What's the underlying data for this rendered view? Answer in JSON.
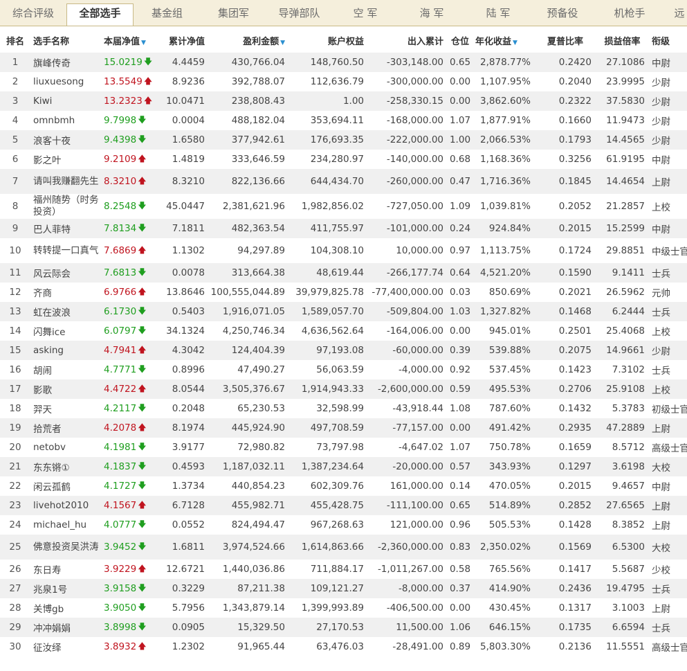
{
  "tabs": [
    {
      "label": "综合评级",
      "active": false
    },
    {
      "label": "全部选手",
      "active": true
    },
    {
      "label": "基金组",
      "active": false
    },
    {
      "label": "集团军",
      "active": false
    },
    {
      "label": "导弹部队",
      "active": false
    },
    {
      "label": "空  军",
      "active": false
    },
    {
      "label": "海  军",
      "active": false
    },
    {
      "label": "陆  军",
      "active": false
    },
    {
      "label": "预备役",
      "active": false
    },
    {
      "label": "机枪手",
      "active": false
    },
    {
      "label": "远",
      "active": false
    }
  ],
  "columns": {
    "rank": "排名",
    "name": "选手名称",
    "nav": "本届净值",
    "cum_nav": "累计净值",
    "profit": "盈利金额",
    "equity": "账户权益",
    "flow": "出入累计",
    "position": "仓位",
    "annual": "年化收益",
    "sharpe": "夏普比率",
    "pl_ratio": "损益倍率",
    "title": "衔级"
  },
  "sort_icon": "sort-desc-triangle",
  "colors": {
    "up": "#c0141f",
    "down": "#1f9e1f",
    "sort": "#2a8fd0"
  },
  "rows": [
    {
      "rank": "1",
      "name": "旗峰传奇",
      "nav": "15.0219",
      "dir": "down",
      "cum_nav": "4.4459",
      "profit": "430,766.04",
      "equity": "148,760.50",
      "flow": "-303,148.00",
      "position": "0.65",
      "annual": "2,878.77%",
      "sharpe": "0.2420",
      "pl_ratio": "27.1086",
      "title": "中尉"
    },
    {
      "rank": "2",
      "name": "liuxuesong",
      "nav": "13.5549",
      "dir": "up",
      "cum_nav": "8.9236",
      "profit": "392,788.07",
      "equity": "112,636.79",
      "flow": "-300,000.00",
      "position": "0.00",
      "annual": "1,107.95%",
      "sharpe": "0.2040",
      "pl_ratio": "23.9995",
      "title": "少尉"
    },
    {
      "rank": "3",
      "name": "Kiwi",
      "nav": "13.2323",
      "dir": "up",
      "cum_nav": "10.0471",
      "profit": "238,808.43",
      "equity": "1.00",
      "flow": "-258,330.15",
      "position": "0.00",
      "annual": "3,862.60%",
      "sharpe": "0.2322",
      "pl_ratio": "37.5830",
      "title": "少尉"
    },
    {
      "rank": "4",
      "name": "omnbmh",
      "nav": "9.7998",
      "dir": "down",
      "cum_nav": "0.0004",
      "profit": "488,182.04",
      "equity": "353,694.11",
      "flow": "-168,000.00",
      "position": "1.07",
      "annual": "1,877.91%",
      "sharpe": "0.1660",
      "pl_ratio": "11.9473",
      "title": "少尉"
    },
    {
      "rank": "5",
      "name": "浪客十夜",
      "nav": "9.4398",
      "dir": "down",
      "cum_nav": "1.6580",
      "profit": "377,942.61",
      "equity": "176,693.35",
      "flow": "-222,000.00",
      "position": "1.00",
      "annual": "2,066.53%",
      "sharpe": "0.1793",
      "pl_ratio": "14.4565",
      "title": "少尉"
    },
    {
      "rank": "6",
      "name": "影之叶",
      "nav": "9.2109",
      "dir": "up",
      "cum_nav": "1.4819",
      "profit": "333,646.59",
      "equity": "234,280.97",
      "flow": "-140,000.00",
      "position": "0.68",
      "annual": "1,168.36%",
      "sharpe": "0.3256",
      "pl_ratio": "61.9195",
      "title": "中尉"
    },
    {
      "rank": "7",
      "name": "请叫我赚翻先生",
      "nav": "8.3210",
      "dir": "up",
      "cum_nav": "8.3210",
      "profit": "822,136.66",
      "equity": "644,434.70",
      "flow": "-260,000.00",
      "position": "0.47",
      "annual": "1,716.36%",
      "sharpe": "0.1845",
      "pl_ratio": "14.4654",
      "title": "上尉",
      "wrap": true
    },
    {
      "rank": "8",
      "name": "福州随势（时务投资）",
      "nav": "8.2548",
      "dir": "down",
      "cum_nav": "45.0447",
      "profit": "2,381,621.96",
      "equity": "1,982,856.02",
      "flow": "-727,050.00",
      "position": "1.09",
      "annual": "1,039.81%",
      "sharpe": "0.2052",
      "pl_ratio": "21.2857",
      "title": "上校",
      "wrap": true
    },
    {
      "rank": "9",
      "name": "巴人菲特",
      "nav": "7.8134",
      "dir": "down",
      "cum_nav": "7.1811",
      "profit": "482,363.54",
      "equity": "411,755.97",
      "flow": "-101,000.00",
      "position": "0.24",
      "annual": "924.84%",
      "sharpe": "0.2015",
      "pl_ratio": "15.2599",
      "title": "中尉"
    },
    {
      "rank": "10",
      "name": "转转提一口真气",
      "nav": "7.6869",
      "dir": "up",
      "cum_nav": "1.1302",
      "profit": "94,297.89",
      "equity": "104,308.10",
      "flow": "10,000.00",
      "position": "0.97",
      "annual": "1,113.75%",
      "sharpe": "0.1724",
      "pl_ratio": "29.8851",
      "title": "中级士官",
      "wrap": true
    },
    {
      "rank": "11",
      "name": "风云际会",
      "nav": "7.6813",
      "dir": "down",
      "cum_nav": "0.0078",
      "profit": "313,664.38",
      "equity": "48,619.44",
      "flow": "-266,177.74",
      "position": "0.64",
      "annual": "4,521.20%",
      "sharpe": "0.1590",
      "pl_ratio": "9.1411",
      "title": "士兵"
    },
    {
      "rank": "12",
      "name": "齐商",
      "nav": "6.9766",
      "dir": "up",
      "cum_nav": "13.8646",
      "profit": "100,555,044.89",
      "equity": "39,979,825.78",
      "flow": "-77,400,000.00",
      "position": "0.03",
      "annual": "850.69%",
      "sharpe": "0.2021",
      "pl_ratio": "26.5962",
      "title": "元帅"
    },
    {
      "rank": "13",
      "name": "虹在波浪",
      "nav": "6.1730",
      "dir": "down",
      "cum_nav": "0.5403",
      "profit": "1,916,071.05",
      "equity": "1,589,057.70",
      "flow": "-509,804.00",
      "position": "1.03",
      "annual": "1,327.82%",
      "sharpe": "0.1468",
      "pl_ratio": "6.2444",
      "title": "士兵"
    },
    {
      "rank": "14",
      "name": "闪舞ice",
      "nav": "6.0797",
      "dir": "down",
      "cum_nav": "34.1324",
      "profit": "4,250,746.34",
      "equity": "4,636,562.64",
      "flow": "-164,006.00",
      "position": "0.00",
      "annual": "945.01%",
      "sharpe": "0.2501",
      "pl_ratio": "25.4068",
      "title": "上校"
    },
    {
      "rank": "15",
      "name": "asking",
      "nav": "4.7941",
      "dir": "up",
      "cum_nav": "4.3042",
      "profit": "124,404.39",
      "equity": "97,193.08",
      "flow": "-60,000.00",
      "position": "0.39",
      "annual": "539.88%",
      "sharpe": "0.2075",
      "pl_ratio": "14.9661",
      "title": "少尉"
    },
    {
      "rank": "16",
      "name": "胡闹",
      "nav": "4.7771",
      "dir": "down",
      "cum_nav": "0.8996",
      "profit": "47,490.27",
      "equity": "56,063.59",
      "flow": "-4,000.00",
      "position": "0.92",
      "annual": "537.45%",
      "sharpe": "0.1423",
      "pl_ratio": "7.3102",
      "title": "士兵"
    },
    {
      "rank": "17",
      "name": "影歌",
      "nav": "4.4722",
      "dir": "up",
      "cum_nav": "8.0544",
      "profit": "3,505,376.67",
      "equity": "1,914,943.33",
      "flow": "-2,600,000.00",
      "position": "0.59",
      "annual": "495.53%",
      "sharpe": "0.2706",
      "pl_ratio": "25.9108",
      "title": "上校"
    },
    {
      "rank": "18",
      "name": "羿天",
      "nav": "4.2117",
      "dir": "down",
      "cum_nav": "0.2048",
      "profit": "65,230.53",
      "equity": "32,598.99",
      "flow": "-43,918.44",
      "position": "1.08",
      "annual": "787.60%",
      "sharpe": "0.1432",
      "pl_ratio": "5.3783",
      "title": "初级士官"
    },
    {
      "rank": "19",
      "name": "拾荒者",
      "nav": "4.2078",
      "dir": "up",
      "cum_nav": "8.1974",
      "profit": "445,924.90",
      "equity": "497,708.59",
      "flow": "-77,157.00",
      "position": "0.00",
      "annual": "491.42%",
      "sharpe": "0.2935",
      "pl_ratio": "47.2889",
      "title": "上尉"
    },
    {
      "rank": "20",
      "name": "netobv",
      "nav": "4.1981",
      "dir": "down",
      "cum_nav": "3.9177",
      "profit": "72,980.82",
      "equity": "73,797.98",
      "flow": "-4,647.02",
      "position": "1.07",
      "annual": "750.78%",
      "sharpe": "0.1659",
      "pl_ratio": "8.5712",
      "title": "高级士官"
    },
    {
      "rank": "21",
      "name": "东东锵①",
      "nav": "4.1837",
      "dir": "down",
      "cum_nav": "0.4593",
      "profit": "1,187,032.11",
      "equity": "1,387,234.64",
      "flow": "-20,000.00",
      "position": "0.57",
      "annual": "343.93%",
      "sharpe": "0.1297",
      "pl_ratio": "3.6198",
      "title": "大校"
    },
    {
      "rank": "22",
      "name": "闲云孤鹤",
      "nav": "4.1727",
      "dir": "down",
      "cum_nav": "1.3734",
      "profit": "440,854.23",
      "equity": "602,309.76",
      "flow": "161,000.00",
      "position": "0.14",
      "annual": "470.05%",
      "sharpe": "0.2015",
      "pl_ratio": "9.4657",
      "title": "中尉"
    },
    {
      "rank": "23",
      "name": "livehot2010",
      "nav": "4.1567",
      "dir": "up",
      "cum_nav": "6.7128",
      "profit": "455,982.71",
      "equity": "455,428.75",
      "flow": "-111,100.00",
      "position": "0.65",
      "annual": "514.89%",
      "sharpe": "0.2852",
      "pl_ratio": "27.6565",
      "title": "上尉"
    },
    {
      "rank": "24",
      "name": "michael_hu",
      "nav": "4.0777",
      "dir": "down",
      "cum_nav": "0.0552",
      "profit": "824,494.47",
      "equity": "967,268.63",
      "flow": "121,000.00",
      "position": "0.96",
      "annual": "505.53%",
      "sharpe": "0.1428",
      "pl_ratio": "8.3852",
      "title": "上尉"
    },
    {
      "rank": "25",
      "name": "佛意投资吴洪涛",
      "nav": "3.9452",
      "dir": "down",
      "cum_nav": "1.6811",
      "profit": "3,974,524.66",
      "equity": "1,614,863.66",
      "flow": "-2,360,000.00",
      "position": "0.83",
      "annual": "2,350.02%",
      "sharpe": "0.1569",
      "pl_ratio": "6.5300",
      "title": "大校",
      "wrap": true
    },
    {
      "rank": "26",
      "name": "东日寿",
      "nav": "3.9229",
      "dir": "up",
      "cum_nav": "12.6721",
      "profit": "1,440,036.86",
      "equity": "711,884.17",
      "flow": "-1,011,267.00",
      "position": "0.58",
      "annual": "765.56%",
      "sharpe": "0.1417",
      "pl_ratio": "5.5687",
      "title": "少校"
    },
    {
      "rank": "27",
      "name": "兆泉1号",
      "nav": "3.9158",
      "dir": "down",
      "cum_nav": "0.3229",
      "profit": "87,211.38",
      "equity": "109,121.27",
      "flow": "-8,000.00",
      "position": "0.37",
      "annual": "414.90%",
      "sharpe": "0.2436",
      "pl_ratio": "19.4795",
      "title": "士兵"
    },
    {
      "rank": "28",
      "name": "关博gb",
      "nav": "3.9050",
      "dir": "down",
      "cum_nav": "5.7956",
      "profit": "1,343,879.14",
      "equity": "1,399,993.89",
      "flow": "-406,500.00",
      "position": "0.00",
      "annual": "430.45%",
      "sharpe": "0.1317",
      "pl_ratio": "3.1003",
      "title": "上尉"
    },
    {
      "rank": "29",
      "name": "冲冲娟娟",
      "nav": "3.8998",
      "dir": "down",
      "cum_nav": "0.0905",
      "profit": "15,329.50",
      "equity": "27,170.53",
      "flow": "11,500.00",
      "position": "1.06",
      "annual": "646.15%",
      "sharpe": "0.1735",
      "pl_ratio": "6.6594",
      "title": "士兵"
    },
    {
      "rank": "30",
      "name": "征汝绎",
      "nav": "3.8932",
      "dir": "up",
      "cum_nav": "1.2302",
      "profit": "91,965.44",
      "equity": "63,476.03",
      "flow": "-28,491.00",
      "position": "0.89",
      "annual": "5,803.30%",
      "sharpe": "0.2136",
      "pl_ratio": "11.5551",
      "title": "高级士官"
    }
  ]
}
